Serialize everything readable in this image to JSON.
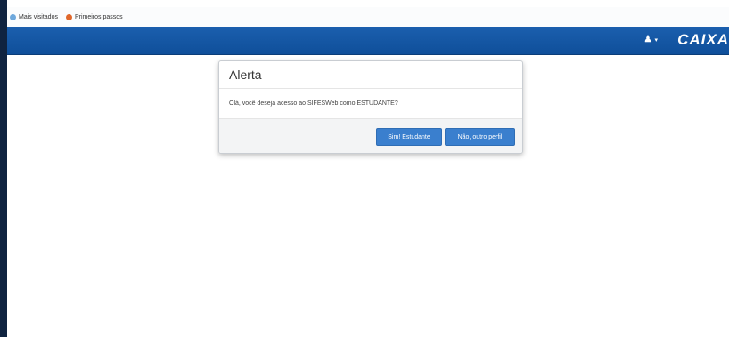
{
  "bookmarks": [
    {
      "label": "Mais visitados",
      "icon": "globe-icon"
    },
    {
      "label": "Primeiros passos",
      "icon": "firefox-icon"
    }
  ],
  "header": {
    "user_icon": "user-icon",
    "logo": "CAIXA",
    "colors": {
      "bar": "#1b5fae",
      "frame": "#0f2340"
    }
  },
  "modal": {
    "title": "Alerta",
    "message": "Olá, você deseja acesso ao SIFESWeb como ESTUDANTE?",
    "buttons": {
      "student": "Sim! Estudante",
      "other": "Não, outro perfil"
    },
    "button_color": "#3a7fce"
  }
}
